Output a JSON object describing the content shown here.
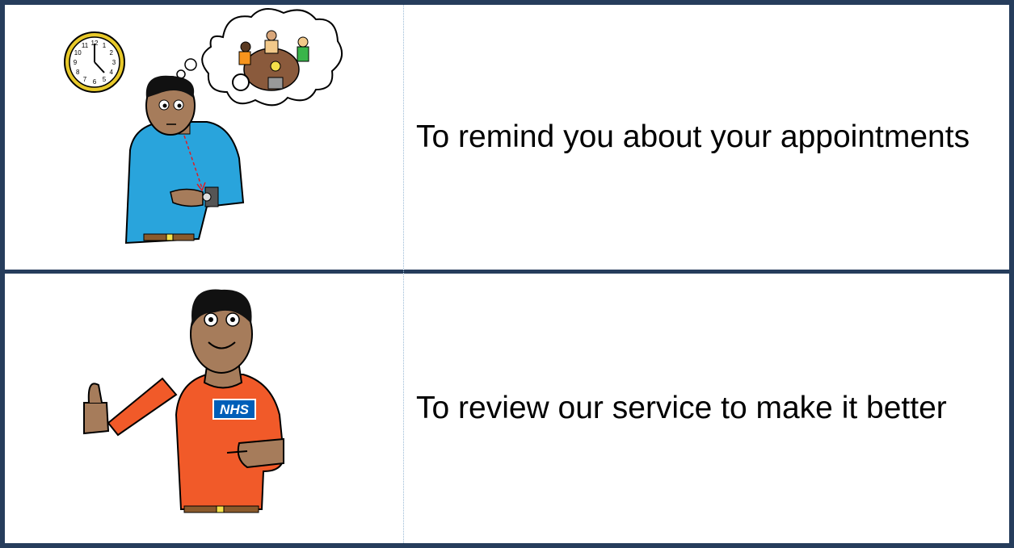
{
  "rows": [
    {
      "caption": "To remind you about your appointments",
      "picture": "person-checking-watch-thinking-of-meeting",
      "clock_numbers": [
        "12",
        "1",
        "2",
        "3",
        "4",
        "5",
        "6",
        "7",
        "8",
        "9",
        "10",
        "11"
      ]
    },
    {
      "caption": "To review our service to make it better",
      "picture": "nhs-staff-thumbs-up",
      "badge_text": "NHS"
    }
  ],
  "colors": {
    "border": "#263d5c",
    "divider_dotted": "#9bbad6",
    "shirt_blue": "#29a4dc",
    "shirt_orange": "#f15a29",
    "skin": "#a67c5b",
    "nhs_blue": "#005eb8"
  }
}
